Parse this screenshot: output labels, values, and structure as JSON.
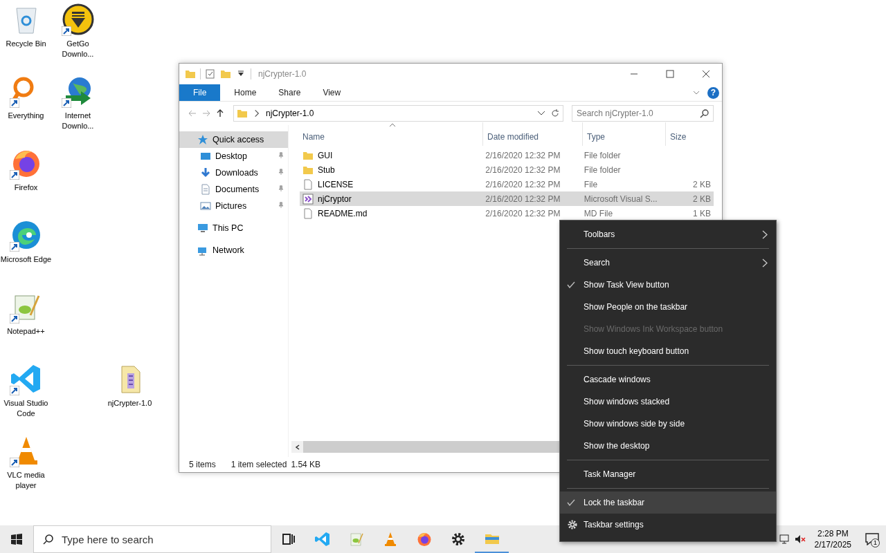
{
  "desktop_icons": [
    {
      "label": "Recycle Bin",
      "kind": "recycle",
      "shortcut": false
    },
    {
      "label": "GetGo Downlo...",
      "kind": "getgo",
      "shortcut": true
    },
    {
      "label": "Everything",
      "kind": "everything",
      "shortcut": true
    },
    {
      "label": "Internet Downlo...",
      "kind": "globe",
      "shortcut": true
    },
    {
      "label": "Firefox",
      "kind": "firefox",
      "shortcut": true
    },
    {
      "label": "Microsoft Edge",
      "kind": "edge",
      "shortcut": true
    },
    {
      "label": "Notepad++",
      "kind": "notepad",
      "shortcut": true
    },
    {
      "label": "Visual Studio Code",
      "kind": "vscode",
      "shortcut": true
    },
    {
      "label": "njCrypter-1.0",
      "kind": "archive",
      "shortcut": false
    },
    {
      "label": "VLC media player",
      "kind": "vlc",
      "shortcut": true
    }
  ],
  "explorer": {
    "title": "njCrypter-1.0",
    "ribbon_tabs": [
      {
        "label": "File",
        "kind": "menu",
        "selected": false
      },
      {
        "label": "Home",
        "kind": "tab",
        "selected": false
      },
      {
        "label": "Share",
        "kind": "tab",
        "selected": false
      },
      {
        "label": "View",
        "kind": "tab",
        "selected": false
      }
    ],
    "help": "?",
    "address": {
      "path": "njCrypter-1.0"
    },
    "search": {
      "placeholder": "Search njCrypter-1.0"
    },
    "navigation": [
      {
        "label": "Quick access",
        "kind": "star",
        "selected": true,
        "children": [
          {
            "label": "Desktop",
            "kind": "desktop",
            "pinned": true,
            "selected": false
          },
          {
            "label": "Downloads",
            "kind": "downloads",
            "pinned": true,
            "selected": false
          },
          {
            "label": "Documents",
            "kind": "documents",
            "pinned": true,
            "selected": false
          },
          {
            "label": "Pictures",
            "kind": "pictures",
            "pinned": true,
            "selected": false
          }
        ]
      },
      {
        "label": "This PC",
        "kind": "pc",
        "selected": false
      },
      {
        "label": "Network",
        "kind": "network",
        "selected": false
      }
    ],
    "columns": [
      {
        "label": "Name",
        "sorted": true
      },
      {
        "label": "Date modified",
        "sorted": false
      },
      {
        "label": "Type",
        "sorted": false
      },
      {
        "label": "Size",
        "sorted": false
      }
    ],
    "rows": [
      {
        "name": "GUI",
        "date": "2/16/2020 12:32 PM",
        "type": "File folder",
        "size": "",
        "kind": "folder",
        "selected": false
      },
      {
        "name": "Stub",
        "date": "2/16/2020 12:32 PM",
        "type": "File folder",
        "size": "",
        "kind": "folder",
        "selected": false
      },
      {
        "name": "LICENSE",
        "date": "2/16/2020 12:32 PM",
        "type": "File",
        "size": "2 KB",
        "kind": "file",
        "selected": false
      },
      {
        "name": "njCryptor",
        "date": "2/16/2020 12:32 PM",
        "type": "Microsoft Visual S...",
        "size": "2 KB",
        "kind": "solution",
        "selected": true
      },
      {
        "name": "README.md",
        "date": "2/16/2020 12:32 PM",
        "type": "MD File",
        "size": "1 KB",
        "kind": "file",
        "selected": false
      }
    ],
    "status_bar": {
      "item_count": "5 items",
      "selection": "1 item selected",
      "selection_size": "1.54 KB"
    }
  },
  "context_menu": [
    {
      "kind": "item",
      "label": "Toolbars",
      "submenu": true,
      "checked": false,
      "disabled": false,
      "selected": false
    },
    {
      "kind": "separator"
    },
    {
      "kind": "item",
      "label": "Search",
      "submenu": true,
      "checked": false,
      "disabled": false,
      "selected": false
    },
    {
      "kind": "item",
      "label": "Show Task View button",
      "submenu": false,
      "checked": true,
      "disabled": false,
      "selected": false
    },
    {
      "kind": "item",
      "label": "Show People on the taskbar",
      "submenu": false,
      "checked": false,
      "disabled": false,
      "selected": false
    },
    {
      "kind": "item",
      "label": "Show Windows Ink Workspace button",
      "submenu": false,
      "checked": false,
      "disabled": true,
      "selected": false
    },
    {
      "kind": "item",
      "label": "Show touch keyboard button",
      "submenu": false,
      "checked": false,
      "disabled": false,
      "selected": false
    },
    {
      "kind": "separator"
    },
    {
      "kind": "item",
      "label": "Cascade windows",
      "submenu": false,
      "checked": false,
      "disabled": false,
      "selected": false
    },
    {
      "kind": "item",
      "label": "Show windows stacked",
      "submenu": false,
      "checked": false,
      "disabled": false,
      "selected": false
    },
    {
      "kind": "item",
      "label": "Show windows side by side",
      "submenu": false,
      "checked": false,
      "disabled": false,
      "selected": false
    },
    {
      "kind": "item",
      "label": "Show the desktop",
      "submenu": false,
      "checked": false,
      "disabled": false,
      "selected": false
    },
    {
      "kind": "separator"
    },
    {
      "kind": "item",
      "label": "Task Manager",
      "submenu": false,
      "checked": false,
      "disabled": false,
      "selected": false
    },
    {
      "kind": "separator"
    },
    {
      "kind": "item",
      "label": "Lock the taskbar",
      "submenu": false,
      "checked": true,
      "disabled": false,
      "selected": true
    },
    {
      "kind": "settings",
      "label": "Taskbar settings",
      "submenu": false,
      "checked": false,
      "disabled": false,
      "selected": false
    }
  ],
  "taskbar": {
    "search": {
      "placeholder": "Type here to search"
    },
    "apps": [
      {
        "kind": "taskview",
        "open": false
      },
      {
        "kind": "vscode",
        "open": false
      },
      {
        "kind": "notepad",
        "open": false
      },
      {
        "kind": "vlc",
        "open": false
      },
      {
        "kind": "firefox",
        "open": false
      },
      {
        "kind": "settings",
        "open": false
      },
      {
        "kind": "explorer",
        "open": true
      }
    ],
    "clock": {
      "time": "2:28 PM",
      "date": "2/17/2025"
    },
    "notifications": "1"
  }
}
